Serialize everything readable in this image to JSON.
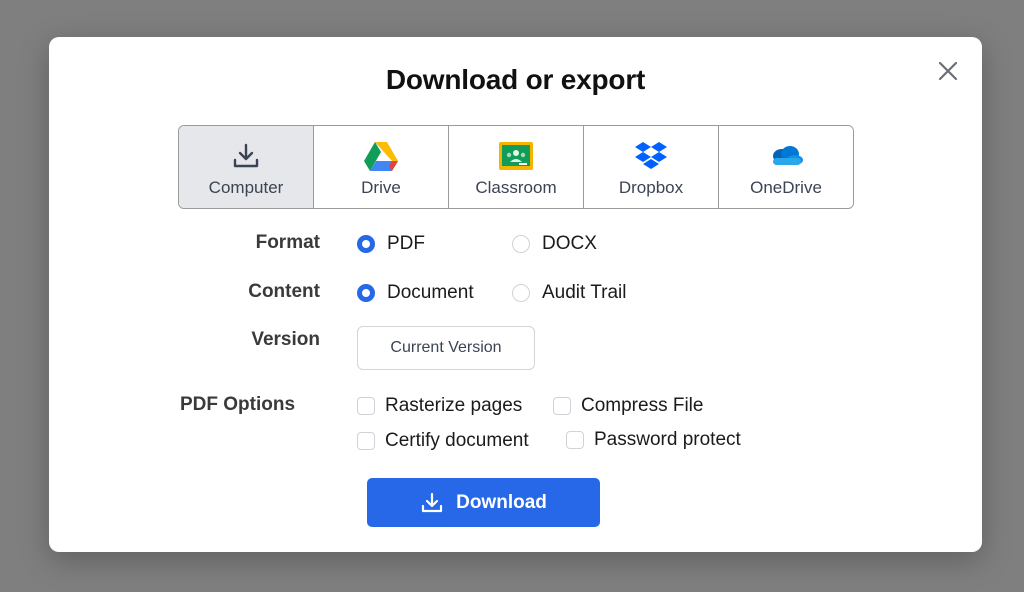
{
  "dialog": {
    "title": "Download or export",
    "close_icon": "close-icon"
  },
  "destinations": [
    {
      "label": "Computer",
      "icon": "download-icon",
      "selected": true
    },
    {
      "label": "Drive",
      "icon": "google-drive-icon",
      "selected": false
    },
    {
      "label": "Classroom",
      "icon": "google-classroom-icon",
      "selected": false
    },
    {
      "label": "Dropbox",
      "icon": "dropbox-icon",
      "selected": false
    },
    {
      "label": "OneDrive",
      "icon": "onedrive-icon",
      "selected": false
    }
  ],
  "format": {
    "label": "Format",
    "options": [
      {
        "label": "PDF",
        "selected": true
      },
      {
        "label": "DOCX",
        "selected": false
      }
    ]
  },
  "content": {
    "label": "Content",
    "options": [
      {
        "label": "Document",
        "selected": true
      },
      {
        "label": "Audit Trail",
        "selected": false
      }
    ]
  },
  "version": {
    "label": "Version",
    "value": "Current Version"
  },
  "pdf_options": {
    "label": "PDF Options",
    "items": [
      {
        "label": "Rasterize pages",
        "checked": false
      },
      {
        "label": "Compress File",
        "checked": false
      },
      {
        "label": "Certify document",
        "checked": false
      },
      {
        "label": "Password protect",
        "checked": false
      }
    ]
  },
  "download_button": {
    "label": "Download",
    "icon": "download-icon"
  },
  "colors": {
    "accent": "#2668e8",
    "overlay": "#7f7f7f",
    "selected_tab": "#e6e7ea"
  }
}
